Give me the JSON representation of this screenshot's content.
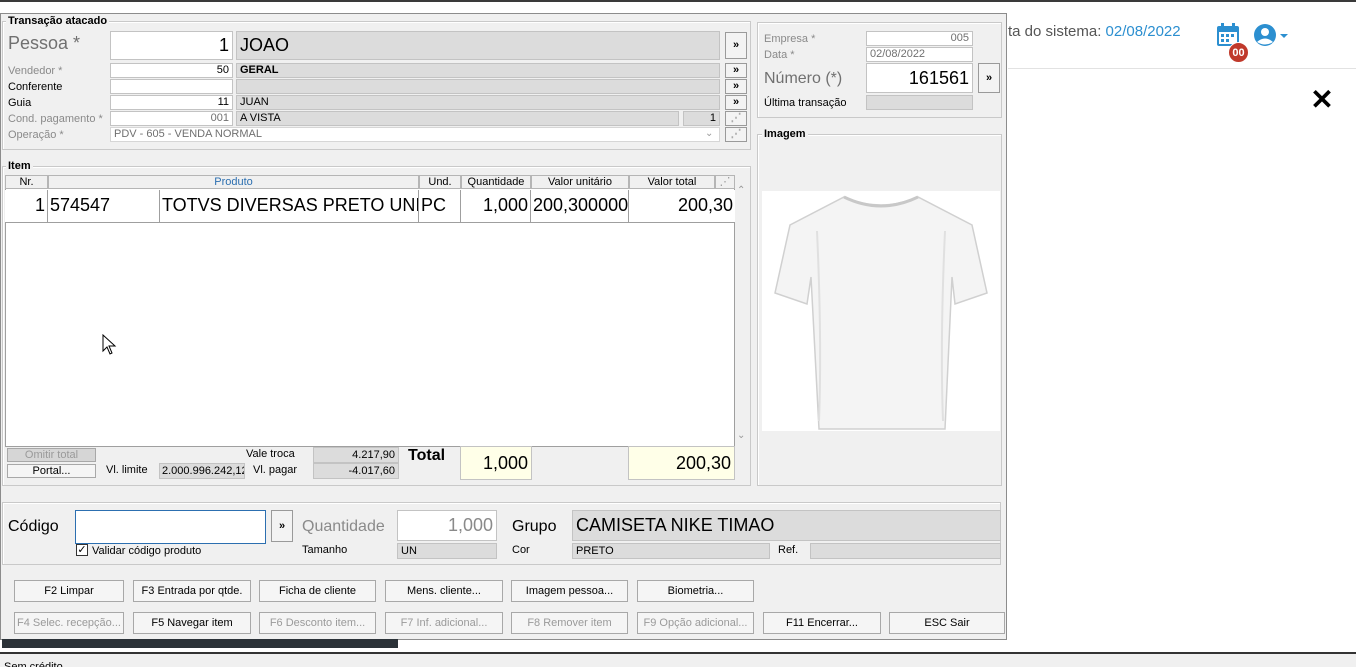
{
  "header": {
    "date_label": "ta do sistema: ",
    "date_value": "02/08/2022",
    "badge_count": "00"
  },
  "transacao": {
    "title": "Transação atacado",
    "pessoa_label": "Pessoa *",
    "pessoa_code": "1",
    "pessoa_name": "JOAO",
    "vendedor_label": "Vendedor *",
    "vendedor_code": "50",
    "vendedor_name": "GERAL",
    "conferente_label": "Conferente",
    "guia_label": "Guia",
    "guia_code": "11",
    "guia_name": "JUAN",
    "cond_label": "Cond. pagamento *",
    "cond_code": "001",
    "cond_name": "A VISTA",
    "cond_parcelas": "1",
    "operacao_label": "Operação *",
    "operacao_value": "PDV - 605 - VENDA NORMAL",
    "more": "»"
  },
  "empresa": {
    "empresa_label": "Empresa *",
    "empresa_value": "005",
    "data_label": "Data *",
    "data_value": "02/08/2022",
    "numero_label": "Número (*)",
    "numero_value": "161561",
    "ultima_label": "Última transação",
    "imagem_title": "Imagem"
  },
  "item": {
    "title": "Item",
    "columns": [
      "Nr.",
      "Produto",
      "Und.",
      "Quantidade",
      "Valor unitário",
      "Valor total"
    ],
    "rows": [
      {
        "nr": "1",
        "codigo": "574547",
        "produto": "TOTVS DIVERSAS PRETO UNICO",
        "und": "PC",
        "quantidade": "1,000",
        "valor_unitario": "200,300000",
        "valor_total": "200,30"
      }
    ]
  },
  "totals": {
    "omitir_label": "Omitir total",
    "portal_label": "Portal...",
    "vl_limite_label": "Vl. limite",
    "vl_limite_value": "2.000.996.242,12",
    "vale_troca_label": "Vale troca",
    "vale_troca_value": "4.217,90",
    "vl_pagar_label": "Vl. pagar",
    "vl_pagar_value": "-4.017,60",
    "total_label": "Total",
    "total_qty": "1,000",
    "total_value": "200,30"
  },
  "entry": {
    "codigo_label": "Código",
    "codigo_value": "",
    "validar_label": "Validar código produto",
    "quantidade_label": "Quantidade",
    "quantidade_value": "1,000",
    "tamanho_label": "Tamanho",
    "tamanho_value": "UN",
    "grupo_label": "Grupo",
    "grupo_value": "CAMISETA NIKE TIMAO",
    "cor_label": "Cor",
    "cor_value": "PRETO",
    "ref_label": "Ref."
  },
  "buttons_row1": [
    "F2 Limpar",
    "F3 Entrada por qtde.",
    "Ficha de cliente",
    "Mens. cliente...",
    "Imagem pessoa...",
    "Biometria..."
  ],
  "buttons_row2": [
    "F4 Selec. recepção...",
    "F5 Navegar item",
    "F6 Desconto item...",
    "F7 Inf. adicional...",
    "F8 Remover item",
    "F9 Opção adicional...",
    "F11 Encerrar...",
    "ESC Sair"
  ],
  "status_text": "Sem crédito",
  "colors": {
    "accent": "#2c8fd0",
    "badge": "#c0392b",
    "highlight_field": "#ffffe8"
  }
}
